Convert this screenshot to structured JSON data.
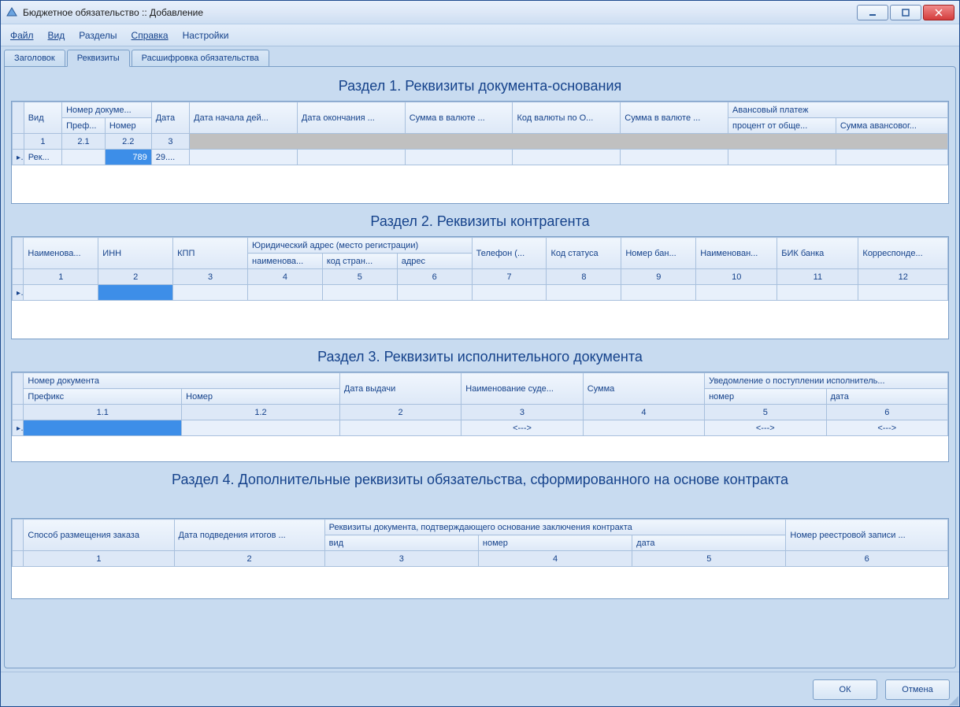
{
  "window": {
    "title": "Бюджетное обязательство :: Добавление"
  },
  "menu": {
    "file": "Файл",
    "view": "Вид",
    "sections": "Разделы",
    "help": "Справка",
    "settings": "Настройки"
  },
  "tabs": {
    "header": "Заголовок",
    "req": "Реквизиты",
    "detail": "Расшифровка обязательства"
  },
  "sec1": {
    "title": "Раздел 1. Реквизиты документа-основания",
    "h": {
      "vid": "Вид",
      "docnum": "Номер докуме...",
      "pref": "Преф...",
      "num": "Номер",
      "date": "Дата",
      "date_start": "Дата начала дей...",
      "date_end": "Дата окончания ...",
      "sum1": "Сумма в валюте ...",
      "code": "Код валюты по О...",
      "sum2": "Сумма в валюте ...",
      "advance": "Авансовый платеж",
      "percent": "процент от обще...",
      "sum_adv": "Сумма авансовог..."
    },
    "nums": {
      "c1": "1",
      "c21": "2.1",
      "c22": "2.2",
      "c3": "3"
    },
    "row": {
      "vid": "Рек...",
      "num": "789",
      "date": "29...."
    }
  },
  "sec2": {
    "title": "Раздел 2. Реквизиты контрагента",
    "h": {
      "name": "Наименова...",
      "inn": "ИНН",
      "kpp": "КПП",
      "addr": "Юридический адрес (место регистрации)",
      "addr_name": "наименова...",
      "addr_code": "код стран...",
      "addr_adr": "адрес",
      "tel": "Телефон (...",
      "status": "Код статуса",
      "bank_num": "Номер бан...",
      "bank_name": "Наименован...",
      "bik": "БИК банка",
      "korr": "Корреспонде..."
    },
    "nums": {
      "c1": "1",
      "c2": "2",
      "c3": "3",
      "c4": "4",
      "c5": "5",
      "c6": "6",
      "c7": "7",
      "c8": "8",
      "c9": "9",
      "c10": "10",
      "c11": "11",
      "c12": "12"
    }
  },
  "sec3": {
    "title": "Раздел 3. Реквизиты исполнительного документа",
    "h": {
      "docnum": "Номер документа",
      "pref": "Префикс",
      "num": "Номер",
      "issue": "Дата выдачи",
      "court": "Наименование суде...",
      "sum": "Сумма",
      "notice": "Уведомление о поступлении исполнитель...",
      "nnum": "номер",
      "ndate": "дата"
    },
    "nums": {
      "c11": "1.1",
      "c12": "1.2",
      "c2": "2",
      "c3": "3",
      "c4": "4",
      "c5": "5",
      "c6": "6"
    },
    "placeholder": "<--->"
  },
  "sec4": {
    "title": "Раздел 4. Дополнительные реквизиты обязательства, сформированного на основе контракта",
    "h": {
      "method": "Способ размещения заказа",
      "date_res": "Дата подведения итогов ...",
      "doc": "Реквизиты документа, подтверждающего основание заключения контракта",
      "vid": "вид",
      "num": "номер",
      "date": "дата",
      "reg": "Номер реестровой записи ..."
    },
    "nums": {
      "c1": "1",
      "c2": "2",
      "c3": "3",
      "c4": "4",
      "c5": "5",
      "c6": "6"
    }
  },
  "buttons": {
    "ok": "ОК",
    "cancel": "Отмена"
  }
}
